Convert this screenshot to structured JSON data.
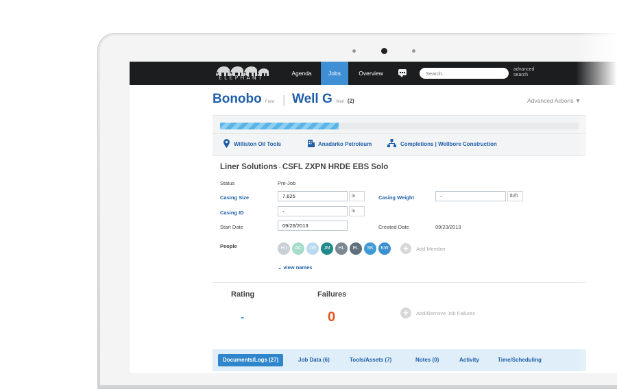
{
  "topbar": {
    "logo_text": "ELEPHANT",
    "nav": [
      {
        "label": "Agenda",
        "active": false
      },
      {
        "label": "Jobs",
        "active": true
      },
      {
        "label": "Overview",
        "active": false
      }
    ],
    "search_placeholder": "Search...",
    "advanced_search_line1": "advanced",
    "advanced_search_line2": "search",
    "chat_icon": "chat-bubble-icon"
  },
  "header": {
    "field_name": "Bonobo",
    "field_label": "Field",
    "separator": "|",
    "well_name": "Well G",
    "well_label": "Well",
    "well_count": "(2)",
    "advanced_actions": "Advanced Actions ▼"
  },
  "progress": {
    "fraction": 0.33
  },
  "companies": [
    {
      "name": "Williston Oil Tools",
      "icon": "map-pin-icon"
    },
    {
      "name": "Anadarko Petroleum",
      "icon": "building-icon"
    },
    {
      "name": "Completions | Wellbore Construction",
      "icon": "org-chart-icon"
    }
  ],
  "job": {
    "title_main": "Liner Solutions",
    "title_dash": " - ",
    "title_sub": "CSFL ZXPN HRDE EBS Solo",
    "status_label": "Status",
    "status_value": "Pre-Job",
    "casing_size_label": "Casing Size",
    "casing_size_value": "7.625",
    "casing_size_unit": "in",
    "casing_weight_label": "Casing Weight",
    "casing_weight_value": "-",
    "casing_weight_unit": "lb/ft",
    "casing_id_label": "Casing ID",
    "casing_id_value": "-",
    "casing_id_unit": "in",
    "start_date_label": "Start Date",
    "start_date_value": "09/26/2013",
    "created_date_label": "Created Date",
    "created_date_value": "09/23/2013",
    "people_label": "People",
    "people": [
      {
        "initials": "HJ",
        "color": "#c9cfd6"
      },
      {
        "initials": "AC",
        "color": "#a6dcc9"
      },
      {
        "initials": "JW",
        "color": "#b9daf0"
      },
      {
        "initials": "JM",
        "color": "#1e8a8a"
      },
      {
        "initials": "HL",
        "color": "#7b8791"
      },
      {
        "initials": "EL",
        "color": "#5f6f7c"
      },
      {
        "initials": "SK",
        "color": "#3f9ad6"
      },
      {
        "initials": "KW",
        "color": "#3b8fd0"
      }
    ],
    "add_member_label": "Add Member",
    "view_names_label": "⌄ view names"
  },
  "stats": {
    "rating_label": "Rating",
    "rating_value": "-",
    "failures_label": "Failures",
    "failures_value": "0",
    "add_failures_label": "Add/Remove Job Failures"
  },
  "tabs": [
    {
      "label": "Documents/Logs (27)",
      "active": true
    },
    {
      "label": "Job Data (6)",
      "active": false
    },
    {
      "label": "Tools/Assets (7)",
      "active": false
    },
    {
      "label": "Notes (0)",
      "active": false
    },
    {
      "label": "Activity",
      "active": false
    },
    {
      "label": "Time/Scheduling",
      "active": false
    }
  ],
  "colors": {
    "brand_blue": "#1f5fa8",
    "nav_active": "#3f8fd4",
    "failure_orange": "#e2541c",
    "topbar": "#1c1d1f"
  }
}
